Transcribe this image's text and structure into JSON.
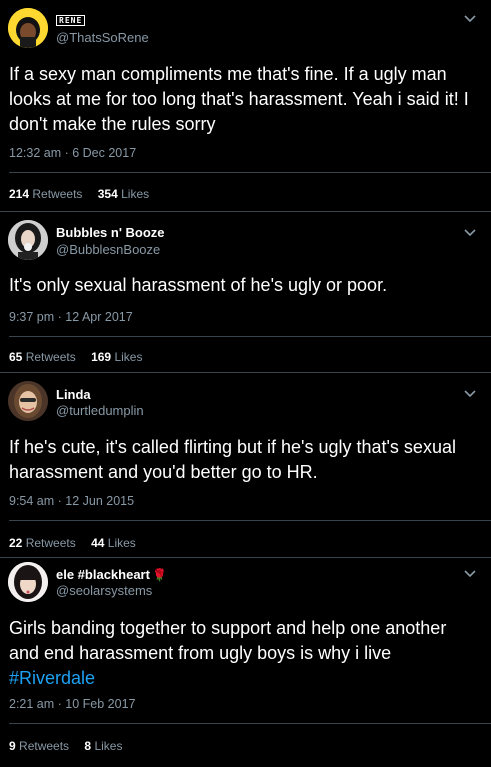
{
  "tweets": [
    {
      "name": "RENE",
      "handle": "@ThatsSoRene",
      "text": "If a sexy man compliments me that's fine. If a ugly man looks at me for too long that's harassment. Yeah i said it! I don't make the rules sorry",
      "timestamp": "12:32 am · 6 Dec 2017",
      "retweets_count": "214",
      "retweets_label": "Retweets",
      "likes_count": "354",
      "likes_label": "Likes"
    },
    {
      "name": "Bubbles n' Booze",
      "handle": "@BubblesnBooze",
      "text": "It's only sexual harassment of he's ugly or poor.",
      "timestamp": "9:37 pm · 12 Apr 2017",
      "retweets_count": "65",
      "retweets_label": "Retweets",
      "likes_count": "169",
      "likes_label": "Likes"
    },
    {
      "name": "Linda",
      "handle": "@turtledumplin",
      "text": "If he's cute, it's called flirting but if he's ugly that's sexual harassment and you'd better go to HR.",
      "timestamp": "9:54 am · 12 Jun 2015",
      "retweets_count": "22",
      "retweets_label": "Retweets",
      "likes_count": "44",
      "likes_label": "Likes"
    },
    {
      "name": "ele #blackheart",
      "name_emoji": "🌹",
      "handle": "@seolarsystems",
      "text": "Girls banding together to support and help one another and end harassment from ugly boys is why i live",
      "hashtag": "#Riverdale",
      "timestamp": "2:21 am · 10 Feb 2017",
      "retweets_count": "9",
      "retweets_label": "Retweets",
      "likes_count": "8",
      "likes_label": "Likes"
    }
  ],
  "icons": {
    "chevron": "chevron-down-icon"
  },
  "colors": {
    "background": "#000000",
    "text": "#ffffff",
    "secondary_text": "#8899a6",
    "separator": "#38444d",
    "link": "#1da1f2"
  }
}
